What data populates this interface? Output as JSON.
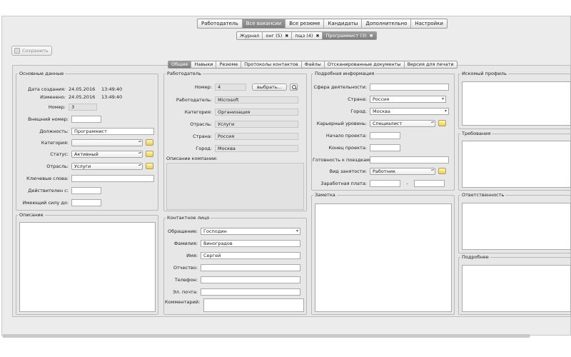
{
  "top_nav": [
    "Работодатель",
    "Все вакансии",
    "Все резюме",
    "Кандидаты",
    "Дополнительно",
    "Настройки"
  ],
  "doc_tabs": [
    {
      "label": "Журнал"
    },
    {
      "label": "онг (5)",
      "close": "✖"
    },
    {
      "label": "пщз (4)",
      "close": "✖"
    },
    {
      "label": "Программист (3)",
      "close": "✖"
    }
  ],
  "toolbar": {
    "save_label": "Сохранить"
  },
  "section_tabs": [
    "Общие",
    "Навыки",
    "Резюме",
    "Протоколы контактов",
    "Файлы",
    "Отсканированные документы",
    "Версия для печати"
  ],
  "basic": {
    "title": "Основные данные",
    "created_label": "Дата создания:",
    "created_date": "24.05.2016",
    "created_time": "13:49:40",
    "modified_label": "Изменено:",
    "modified_date": "24.05.2016",
    "modified_time": "13:49:40",
    "number_label": "Номер:",
    "number": "3",
    "ext_number_label": "Внешний номер:",
    "ext_number": "",
    "position_label": "Должность:",
    "position": "Программист",
    "category_label": "Категория:",
    "category": "",
    "status_label": "Статус:",
    "status": "Активный",
    "industry_label": "Отрасль:",
    "industry": "Услуги",
    "keywords_label": "Ключевые слова:",
    "keywords": "",
    "valid_label": "Действителен с:",
    "valid": "",
    "effective_label": "Имеющий силу до:",
    "effective": ""
  },
  "description": {
    "title": "Описание",
    "text": ""
  },
  "employer": {
    "title": "Работодатель",
    "number_label": "Номер:",
    "number": "4",
    "choose_label": "выбрать...",
    "employer_label": "Работодатель:",
    "employer": "Microsoft",
    "category_label": "Категория:",
    "category": "Организация",
    "industry_label": "Отрасль:",
    "industry": "Услуги",
    "country_label": "Страна:",
    "country": "Россия",
    "city_label": "Город:",
    "city": "Москва",
    "company_desc_label": "Описание компании:",
    "company_desc": ""
  },
  "contact": {
    "title": "Контактное лицо",
    "salutation_label": "Обращение:",
    "salutation": "Господин",
    "last_name_label": "Фамилия:",
    "last_name": "Виноградов",
    "first_name_label": "Имя:",
    "first_name": "Сергей",
    "patronymic_label": "Отчество:",
    "patronymic": "",
    "phone_label": "Телефон:",
    "phone": "",
    "email_label": "Эл. почта:",
    "email": "",
    "comment_label": "Комментарий:",
    "comment": ""
  },
  "details": {
    "title": "Подробная информация",
    "field_label": "Сфера деятельности:",
    "field": "",
    "country_label": "Страна:",
    "country": "Россия",
    "city_label": "Город:",
    "city": "Москва",
    "career_label": "Карьерный уровень:",
    "career": "Специалист",
    "start_label": "Начало проекта:",
    "start": "",
    "end_label": "Конец проекта:",
    "end": "",
    "travel_label": "Готовность к поездкам:",
    "travel": "",
    "employment_label": "Вид занятости:",
    "employment": "Работник",
    "salary_label": "Заработная плата:",
    "salary_from": "",
    "salary_dash": "-",
    "salary_to": ""
  },
  "note": {
    "title": "Заметка",
    "text": ""
  },
  "right": {
    "profile_title": "Искомый профиль",
    "requirements_title": "Требования",
    "responsibility_title": "Ответственность",
    "more_title": "Подробнее"
  }
}
